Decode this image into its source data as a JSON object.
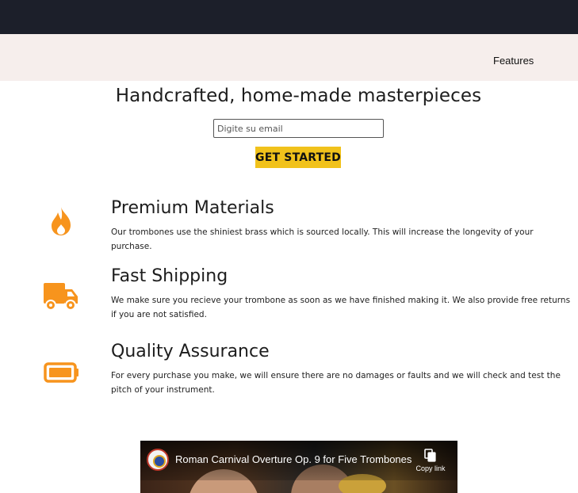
{
  "nav": {
    "links": [
      {
        "label": "Features"
      }
    ]
  },
  "hero": {
    "title": "Handcrafted, home-made masterpieces",
    "email_placeholder": "Digite su email",
    "cta_label": "GET STARTED"
  },
  "features": [
    {
      "icon": "fire-icon",
      "title": "Premium Materials",
      "text": "Our trombones use the shiniest brass which is sourced locally. This will increase the longevity of your purchase."
    },
    {
      "icon": "truck-icon",
      "title": "Fast Shipping",
      "text": "We make sure you recieve your trombone as soon as we have finished making it. We also provide free returns if you are not satisfied."
    },
    {
      "icon": "battery-icon",
      "title": "Quality Assurance",
      "text": "For every purchase you make, we will ensure there are no damages or faults and we will check and test the pitch of your instrument."
    }
  ],
  "video": {
    "title": "Roman Carnival Overture Op. 9 for Five Trombones",
    "copy_link_label": "Copy link"
  },
  "colors": {
    "topbar": "#1c1f2a",
    "navbar": "#f6eeec",
    "accent_icon": "#f7941d",
    "cta": "#f1c21b"
  }
}
